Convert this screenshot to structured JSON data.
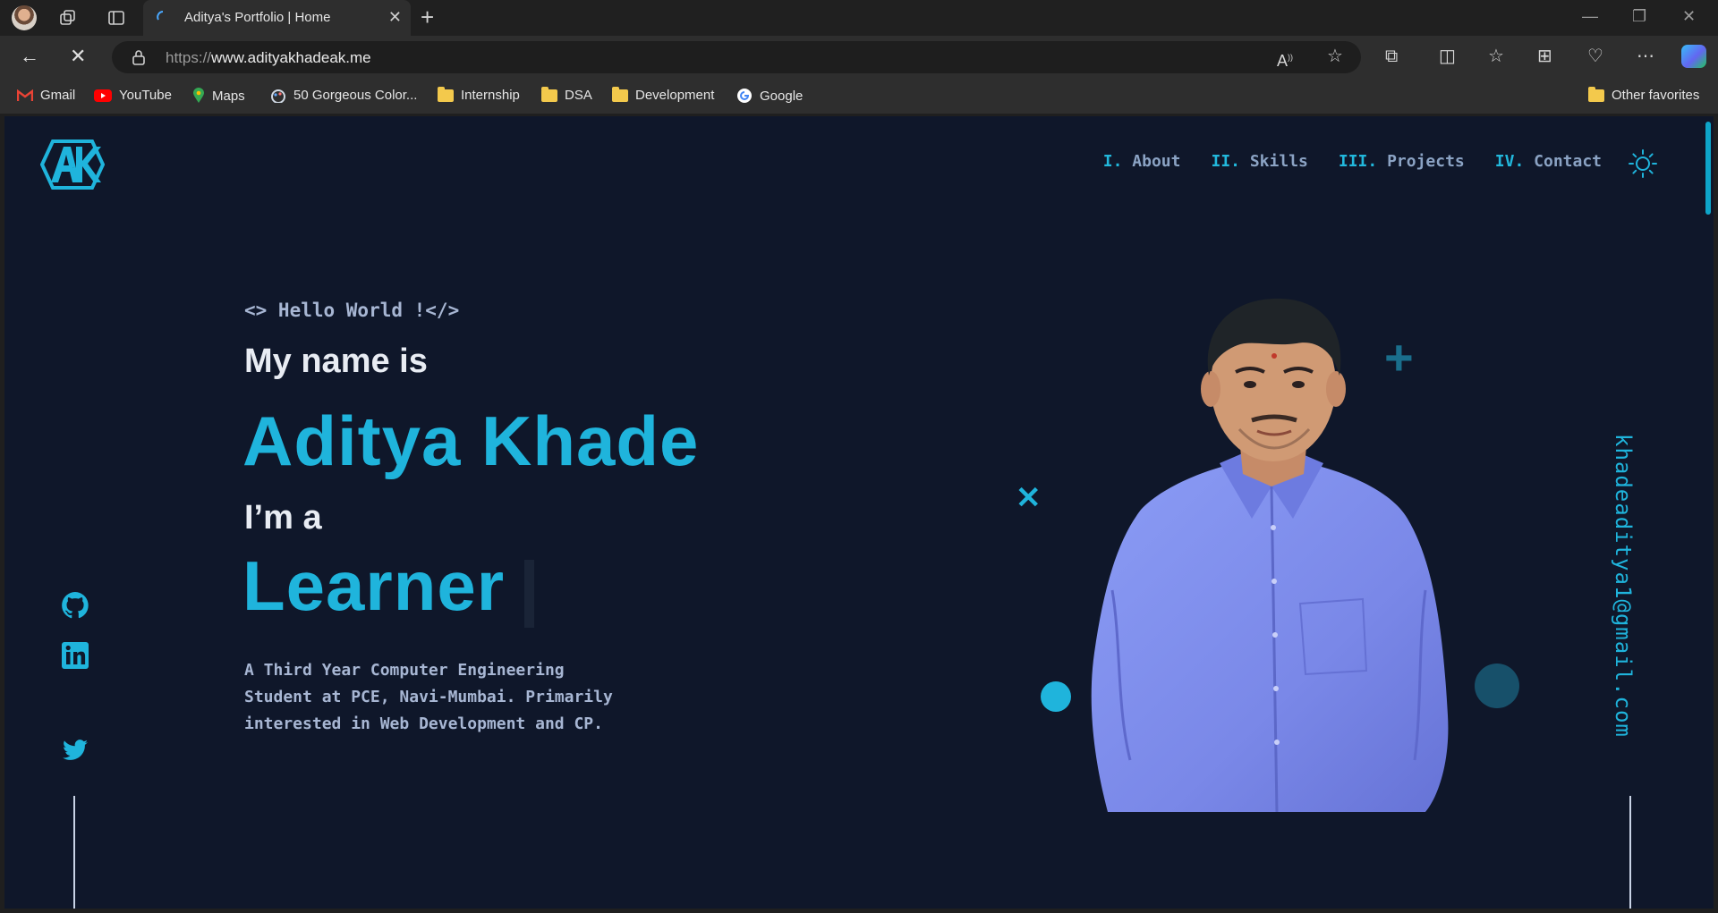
{
  "browser": {
    "tab_title": "Aditya's Portfolio | Home",
    "url_scheme": "https://",
    "url_host": "www.adityakhadeak.me",
    "bookmarks": [
      {
        "label": "Gmail",
        "icon": "gmail-icon"
      },
      {
        "label": "YouTube",
        "icon": "youtube-icon"
      },
      {
        "label": "Maps",
        "icon": "maps-icon"
      },
      {
        "label": "50 Gorgeous Color...",
        "icon": "palette-icon"
      },
      {
        "label": "Internship",
        "icon": "folder-icon"
      },
      {
        "label": "DSA",
        "icon": "folder-icon"
      },
      {
        "label": "Development",
        "icon": "folder-icon"
      },
      {
        "label": "Google",
        "icon": "google-icon"
      }
    ],
    "other_favorites": "Other favorites"
  },
  "site": {
    "logo_text": "AK",
    "nav": [
      {
        "num": "I.",
        "label": "About"
      },
      {
        "num": "II.",
        "label": "Skills"
      },
      {
        "num": "III.",
        "label": "Projects"
      },
      {
        "num": "IV.",
        "label": "Contact"
      }
    ],
    "hero": {
      "greeting": "<> Hello World !</>",
      "intro": "My name is",
      "name": "Aditya Khade",
      "iam": "I’m a",
      "role": "Learner",
      "description": "A Third Year Computer Engineering Student at PCE, Navi-Mumbai. Primarily interested in Web Development and CP."
    },
    "social": [
      "github-icon",
      "linkedin-icon",
      "twitter-icon"
    ],
    "email": "khadeaditya1@gmail.com"
  },
  "colors": {
    "page_bg": "#0f172a",
    "accent": "#1fb4dc",
    "muted_text": "#a7b6d3",
    "heading_text": "#e8ecf3"
  }
}
